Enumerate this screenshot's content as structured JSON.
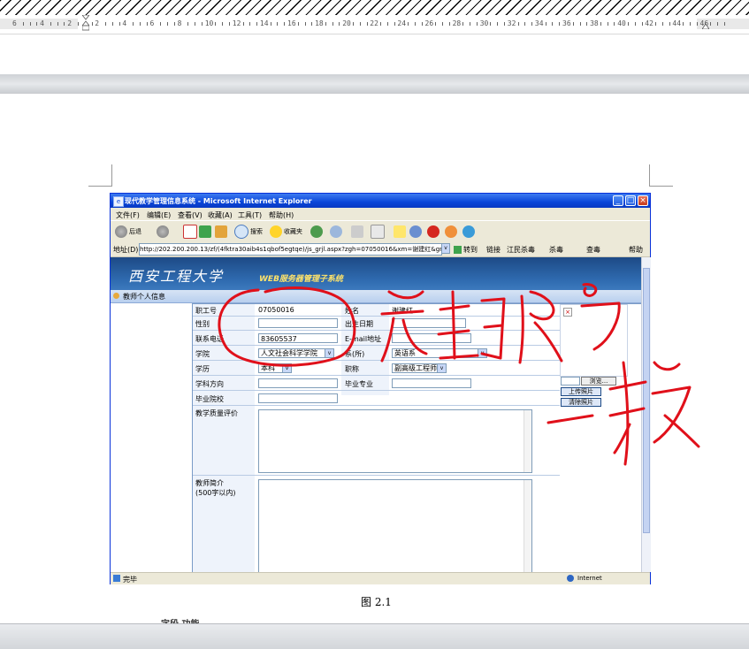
{
  "ruler": {
    "numbers": [
      "6",
      "4",
      "2",
      "2",
      "4",
      "6",
      "8",
      "10",
      "12",
      "14",
      "16",
      "18",
      "20",
      "22",
      "24",
      "26",
      "28",
      "30",
      "32",
      "34",
      "36",
      "38",
      "40",
      "42",
      "44",
      "46"
    ]
  },
  "ie": {
    "title": "现代教学管理信息系统 - Microsoft Internet Explorer",
    "menus": [
      "文件(F)",
      "编辑(E)",
      "查看(V)",
      "收藏(A)",
      "工具(T)",
      "帮助(H)"
    ],
    "toolbar": {
      "back": "后退",
      "search": "搜索",
      "favorites": "收藏夹"
    },
    "address": {
      "label": "地址(D)",
      "url": "http://202.200.200.13/zf/(4fktra30aib4s1qbof5egtqe)/js_grjl.aspx?zgh=07050016&xm=谢建红&gnmk",
      "go": "转到",
      "links": "链接",
      "antivirus1": "江民杀毒",
      "antivirus2": "杀毒",
      "check": "查毒",
      "help": "帮助"
    },
    "status": "完毕",
    "zone": "Internet",
    "close_glyph": "×",
    "minimize_glyph": "_",
    "maximize_glyph": "□",
    "dropdown_glyph": "v"
  },
  "banner": {
    "logo": "西安工程大学",
    "system": "WEB服务器管理子系统"
  },
  "section": {
    "title": "教师个人信息"
  },
  "form": {
    "staff_id_label": "职工号",
    "staff_id_value": "07050016",
    "name_label": "姓名",
    "name_value": "谢建红",
    "gender_label": "性别",
    "birth_label": "出生日期",
    "phone_label": "联系电话",
    "phone_value": "83605537",
    "email_label": "E-mail地址",
    "college_label": "学院",
    "college_value": "人文社会科学学院",
    "dept_label": "系(所)",
    "dept_value": "英语系",
    "edu_label": "学历",
    "edu_value": "本科",
    "title_label": "职称",
    "title_value": "副高级工程师",
    "direction_label": "学科方向",
    "major_label": "毕业专业",
    "school_label": "毕业院校",
    "quality_label": "教学质量评价",
    "intro_label": "教师简介",
    "intro_note": "(500字以内)"
  },
  "photo": {
    "broken_image": "×",
    "browse": "浏览...",
    "upload": "上传照片",
    "clear": "清除照片"
  },
  "caption": "图 2.1",
  "bottom_text": "字段 功能",
  "colors": {
    "ie_title": "#0a46d9",
    "banner": "#1d4a86",
    "ink": "#e0101a"
  }
}
